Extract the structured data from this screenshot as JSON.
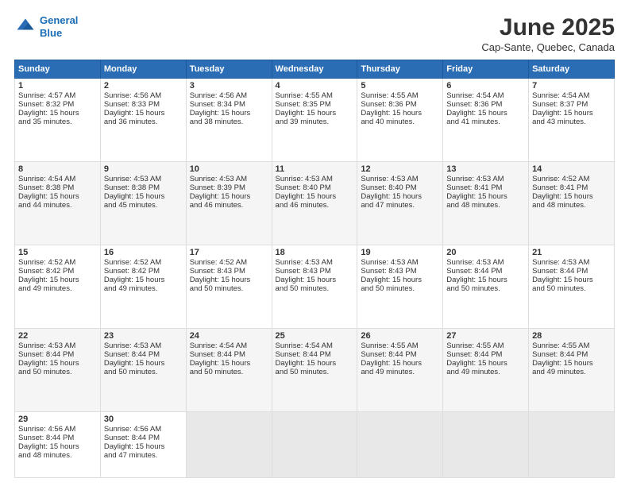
{
  "header": {
    "logo_line1": "General",
    "logo_line2": "Blue",
    "month_title": "June 2025",
    "location": "Cap-Sante, Quebec, Canada"
  },
  "days_of_week": [
    "Sunday",
    "Monday",
    "Tuesday",
    "Wednesday",
    "Thursday",
    "Friday",
    "Saturday"
  ],
  "weeks": [
    [
      {
        "day": 1,
        "lines": [
          "Sunrise: 4:57 AM",
          "Sunset: 8:32 PM",
          "Daylight: 15 hours",
          "and 35 minutes."
        ]
      },
      {
        "day": 2,
        "lines": [
          "Sunrise: 4:56 AM",
          "Sunset: 8:33 PM",
          "Daylight: 15 hours",
          "and 36 minutes."
        ]
      },
      {
        "day": 3,
        "lines": [
          "Sunrise: 4:56 AM",
          "Sunset: 8:34 PM",
          "Daylight: 15 hours",
          "and 38 minutes."
        ]
      },
      {
        "day": 4,
        "lines": [
          "Sunrise: 4:55 AM",
          "Sunset: 8:35 PM",
          "Daylight: 15 hours",
          "and 39 minutes."
        ]
      },
      {
        "day": 5,
        "lines": [
          "Sunrise: 4:55 AM",
          "Sunset: 8:36 PM",
          "Daylight: 15 hours",
          "and 40 minutes."
        ]
      },
      {
        "day": 6,
        "lines": [
          "Sunrise: 4:54 AM",
          "Sunset: 8:36 PM",
          "Daylight: 15 hours",
          "and 41 minutes."
        ]
      },
      {
        "day": 7,
        "lines": [
          "Sunrise: 4:54 AM",
          "Sunset: 8:37 PM",
          "Daylight: 15 hours",
          "and 43 minutes."
        ]
      }
    ],
    [
      {
        "day": 8,
        "lines": [
          "Sunrise: 4:54 AM",
          "Sunset: 8:38 PM",
          "Daylight: 15 hours",
          "and 44 minutes."
        ]
      },
      {
        "day": 9,
        "lines": [
          "Sunrise: 4:53 AM",
          "Sunset: 8:38 PM",
          "Daylight: 15 hours",
          "and 45 minutes."
        ]
      },
      {
        "day": 10,
        "lines": [
          "Sunrise: 4:53 AM",
          "Sunset: 8:39 PM",
          "Daylight: 15 hours",
          "and 46 minutes."
        ]
      },
      {
        "day": 11,
        "lines": [
          "Sunrise: 4:53 AM",
          "Sunset: 8:40 PM",
          "Daylight: 15 hours",
          "and 46 minutes."
        ]
      },
      {
        "day": 12,
        "lines": [
          "Sunrise: 4:53 AM",
          "Sunset: 8:40 PM",
          "Daylight: 15 hours",
          "and 47 minutes."
        ]
      },
      {
        "day": 13,
        "lines": [
          "Sunrise: 4:53 AM",
          "Sunset: 8:41 PM",
          "Daylight: 15 hours",
          "and 48 minutes."
        ]
      },
      {
        "day": 14,
        "lines": [
          "Sunrise: 4:52 AM",
          "Sunset: 8:41 PM",
          "Daylight: 15 hours",
          "and 48 minutes."
        ]
      }
    ],
    [
      {
        "day": 15,
        "lines": [
          "Sunrise: 4:52 AM",
          "Sunset: 8:42 PM",
          "Daylight: 15 hours",
          "and 49 minutes."
        ]
      },
      {
        "day": 16,
        "lines": [
          "Sunrise: 4:52 AM",
          "Sunset: 8:42 PM",
          "Daylight: 15 hours",
          "and 49 minutes."
        ]
      },
      {
        "day": 17,
        "lines": [
          "Sunrise: 4:52 AM",
          "Sunset: 8:43 PM",
          "Daylight: 15 hours",
          "and 50 minutes."
        ]
      },
      {
        "day": 18,
        "lines": [
          "Sunrise: 4:53 AM",
          "Sunset: 8:43 PM",
          "Daylight: 15 hours",
          "and 50 minutes."
        ]
      },
      {
        "day": 19,
        "lines": [
          "Sunrise: 4:53 AM",
          "Sunset: 8:43 PM",
          "Daylight: 15 hours",
          "and 50 minutes."
        ]
      },
      {
        "day": 20,
        "lines": [
          "Sunrise: 4:53 AM",
          "Sunset: 8:44 PM",
          "Daylight: 15 hours",
          "and 50 minutes."
        ]
      },
      {
        "day": 21,
        "lines": [
          "Sunrise: 4:53 AM",
          "Sunset: 8:44 PM",
          "Daylight: 15 hours",
          "and 50 minutes."
        ]
      }
    ],
    [
      {
        "day": 22,
        "lines": [
          "Sunrise: 4:53 AM",
          "Sunset: 8:44 PM",
          "Daylight: 15 hours",
          "and 50 minutes."
        ]
      },
      {
        "day": 23,
        "lines": [
          "Sunrise: 4:53 AM",
          "Sunset: 8:44 PM",
          "Daylight: 15 hours",
          "and 50 minutes."
        ]
      },
      {
        "day": 24,
        "lines": [
          "Sunrise: 4:54 AM",
          "Sunset: 8:44 PM",
          "Daylight: 15 hours",
          "and 50 minutes."
        ]
      },
      {
        "day": 25,
        "lines": [
          "Sunrise: 4:54 AM",
          "Sunset: 8:44 PM",
          "Daylight: 15 hours",
          "and 50 minutes."
        ]
      },
      {
        "day": 26,
        "lines": [
          "Sunrise: 4:55 AM",
          "Sunset: 8:44 PM",
          "Daylight: 15 hours",
          "and 49 minutes."
        ]
      },
      {
        "day": 27,
        "lines": [
          "Sunrise: 4:55 AM",
          "Sunset: 8:44 PM",
          "Daylight: 15 hours",
          "and 49 minutes."
        ]
      },
      {
        "day": 28,
        "lines": [
          "Sunrise: 4:55 AM",
          "Sunset: 8:44 PM",
          "Daylight: 15 hours",
          "and 49 minutes."
        ]
      }
    ],
    [
      {
        "day": 29,
        "lines": [
          "Sunrise: 4:56 AM",
          "Sunset: 8:44 PM",
          "Daylight: 15 hours",
          "and 48 minutes."
        ]
      },
      {
        "day": 30,
        "lines": [
          "Sunrise: 4:56 AM",
          "Sunset: 8:44 PM",
          "Daylight: 15 hours",
          "and 47 minutes."
        ]
      },
      null,
      null,
      null,
      null,
      null
    ]
  ]
}
